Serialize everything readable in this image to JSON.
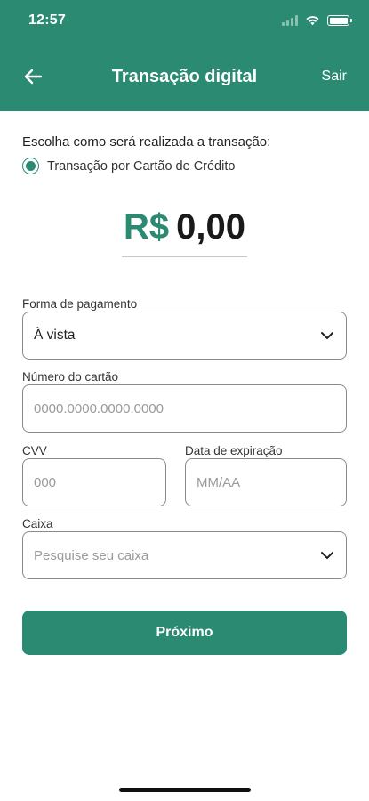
{
  "status_bar": {
    "time": "12:57"
  },
  "nav": {
    "back_icon": "arrow-left-icon",
    "title": "Transação digital",
    "exit_label": "Sair"
  },
  "transaction": {
    "prompt": "Escolha como será realizada a transação:",
    "option_label": "Transação por Cartão de Crédito",
    "option_selected": true
  },
  "amount": {
    "currency": "R$",
    "value": "0,00"
  },
  "form": {
    "payment_method": {
      "label": "Forma de pagamento",
      "value": "À vista"
    },
    "card_number": {
      "label": "Número do cartão",
      "placeholder": "0000.0000.0000.0000"
    },
    "cvv": {
      "label": "CVV",
      "placeholder": "000"
    },
    "expiry": {
      "label": "Data de expiração",
      "placeholder": "MM/AA"
    },
    "cashier": {
      "label": "Caixa",
      "placeholder": "Pesquise seu caixa"
    }
  },
  "actions": {
    "next_label": "Próximo"
  },
  "colors": {
    "brand": "#2a8a72",
    "text": "#1f1f1f",
    "border": "#8a8a8a",
    "placeholder": "#9a9a9a"
  }
}
